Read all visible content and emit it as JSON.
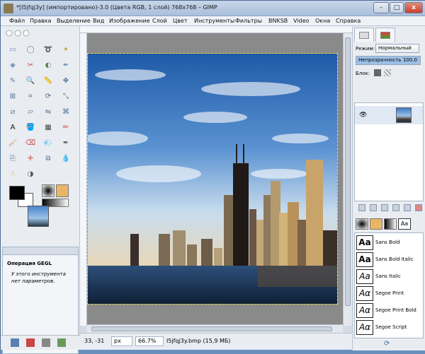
{
  "titlebar": {
    "title": "*[I5jfqj3y] (импортировано)-3.0 (Цвета RGB, 1 слой) 768x768 – GIMP",
    "minimize": "–",
    "maximize": "□",
    "close": "x"
  },
  "menu": [
    "Файл",
    "Правка",
    "Выделение",
    "Вид",
    "Изображение",
    "Слой",
    "Цвет",
    "Инструменты",
    "Фильтры",
    "BNKSB",
    "Video",
    "Окна",
    "Справка"
  ],
  "toolbox": {
    "tool_icons": [
      "rect-select-icon",
      "ellipse-select-icon",
      "lasso-icon",
      "fuzzy-select-icon",
      "color-select-icon",
      "scissors-icon",
      "foreground-select-icon",
      "paths-icon",
      "color-picker-icon",
      "zoom-icon",
      "measure-icon",
      "move-icon",
      "align-icon",
      "crop-icon",
      "rotate-icon",
      "scale-icon",
      "shear-icon",
      "perspective-icon",
      "flip-icon",
      "cage-icon",
      "text-icon",
      "bucket-fill-icon",
      "blend-icon",
      "pencil-icon",
      "paintbrush-icon",
      "eraser-icon",
      "airbrush-icon",
      "ink-icon",
      "clone-icon",
      "heal-icon",
      "perspective-clone-icon",
      "blur-icon",
      "smudge-icon",
      "dodge-burn-icon"
    ],
    "fg_color": "#000000",
    "bg_color": "#ffffff",
    "tool_options_title": "Операция GEGL",
    "tool_options_text": "У этого инструмента нет параметров."
  },
  "status": {
    "coords": "33, -31",
    "unit": "px",
    "zoom": "66.7%",
    "file_info": "I5jfqj3y.bmp (15,9 МБ)"
  },
  "dock": {
    "mode_label": "Режим:",
    "mode_value": "Нормальный",
    "opacity_label": "Непрозрачность",
    "opacity_value": "100.0",
    "lock_label": "Блок:",
    "fonts": [
      {
        "glyph": "Aa",
        "name": "Sans Bold"
      },
      {
        "glyph": "Aa",
        "name": "Sans Bold Italic"
      },
      {
        "glyph": "Aa",
        "name": "Sans Italic"
      },
      {
        "glyph": "Aα",
        "name": "Segoe Print"
      },
      {
        "glyph": "Aα",
        "name": "Segoe Print Bold"
      },
      {
        "glyph": "Aα",
        "name": "Segoe Script"
      }
    ]
  },
  "colors": {
    "accent": "#4a6b94",
    "selection_border": "#e6d84c"
  }
}
